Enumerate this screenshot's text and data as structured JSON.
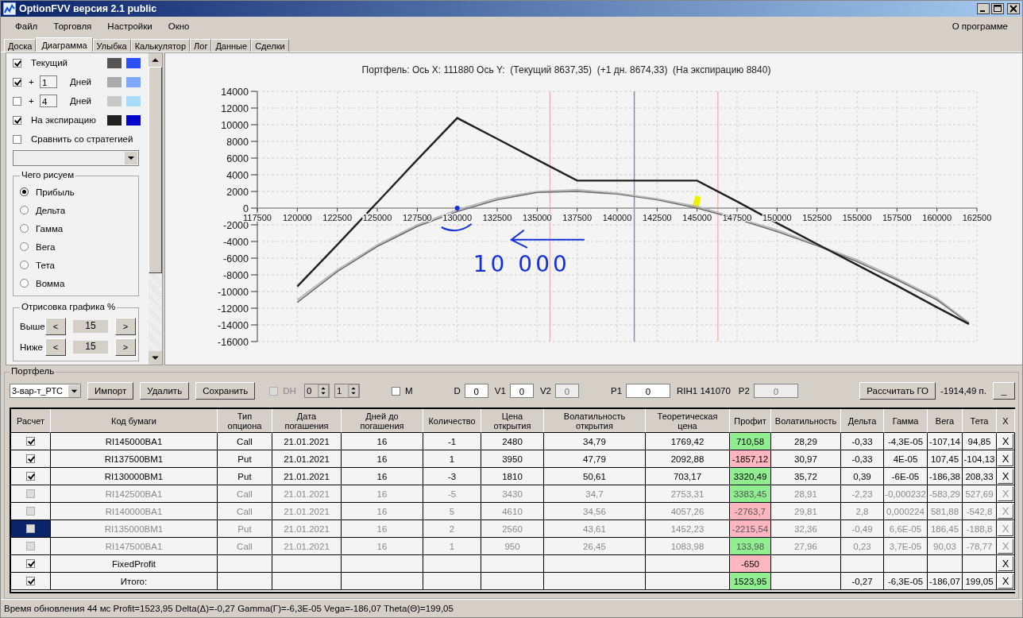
{
  "window": {
    "title": "OptionFVV версия 2.1 public"
  },
  "menu": {
    "items": [
      "Файл",
      "Торговля",
      "Настройки",
      "Окно"
    ],
    "about": "О программе"
  },
  "tabs": [
    {
      "label": "Доска",
      "selected": false
    },
    {
      "label": "Диаграмма",
      "selected": true
    },
    {
      "label": "Улыбка",
      "selected": false
    },
    {
      "label": "Калькулятор",
      "selected": false
    },
    {
      "label": "Лог",
      "selected": false
    },
    {
      "label": "Данные",
      "selected": false
    },
    {
      "label": "Сделки",
      "selected": false
    }
  ],
  "display": {
    "series": [
      {
        "label": "Текущий",
        "checked": true,
        "swatches": [
          {
            "color": "#555555"
          },
          {
            "color": "#2a50ff"
          }
        ]
      },
      {
        "prefix": "+",
        "days": "1",
        "label": "Дней",
        "checked": true,
        "swatches": [
          {
            "color": "#a9a9a9"
          },
          {
            "color": "#7fa8ff"
          }
        ]
      },
      {
        "prefix": "+",
        "days": "4",
        "label": "Дней",
        "checked": false,
        "swatches": [
          {
            "color": "#c8c8c8"
          },
          {
            "color": "#a8dcff"
          }
        ]
      },
      {
        "label": "На экспирацию",
        "checked": true,
        "swatches": [
          {
            "color": "#202020"
          },
          {
            "color": "#0000c8"
          }
        ]
      }
    ],
    "compare": {
      "label": "Сравнить со стратегией",
      "checked": false
    },
    "mode_group": {
      "title": "Чего рисуем",
      "options": [
        {
          "label": "Прибыль",
          "selected": true
        },
        {
          "label": "Дельта",
          "selected": false
        },
        {
          "label": "Гамма",
          "selected": false
        },
        {
          "label": "Вега",
          "selected": false
        },
        {
          "label": "Тета",
          "selected": false
        },
        {
          "label": "Вомма",
          "selected": false
        }
      ]
    },
    "range_group": {
      "title": "Отрисовка графика %",
      "rows": [
        {
          "label": "Выше",
          "value": "15",
          "decrease": "<",
          "increase": ">"
        },
        {
          "label": "Ниже",
          "value": "15",
          "decrease": "<",
          "increase": ">"
        }
      ]
    }
  },
  "chart": {
    "title": "Портфель: Ось X: 111880 Ось Y:  (Текущий 8637,35)  (+1 дн. 8674,33)  (На экспирацию 8840)",
    "note": "10 000",
    "chart_data": {
      "type": "line",
      "grid": true,
      "xlim": [
        117500,
        162500
      ],
      "ylim": [
        -16000,
        14000
      ],
      "xticks": [
        117500,
        120000,
        122500,
        125000,
        127500,
        130000,
        132500,
        135000,
        137500,
        140000,
        142500,
        145000,
        147500,
        150000,
        152500,
        155000,
        157500,
        160000,
        162500
      ],
      "yticks": [
        -16000,
        -14000,
        -12000,
        -10000,
        -8000,
        -6000,
        -4000,
        -2000,
        0,
        2000,
        4000,
        6000,
        8000,
        10000,
        12000,
        14000
      ],
      "x": [
        120000,
        122500,
        125000,
        127500,
        130000,
        132500,
        135000,
        137500,
        140000,
        142500,
        145000,
        147500,
        150000,
        152500,
        155000,
        157500,
        160000,
        162000
      ],
      "series": [
        {
          "color": "#6a6a6a",
          "values": [
            -11300,
            -7600,
            -4600,
            -2200,
            -400,
            1000,
            1900,
            2000,
            1700,
            1000,
            0,
            -1300,
            -2800,
            -4500,
            -6400,
            -8600,
            -11000,
            -13800
          ]
        },
        {
          "color": "#b4b4b4",
          "values": [
            -11000,
            -7400,
            -4400,
            -2000,
            -200,
            1200,
            2000,
            2200,
            1800,
            1100,
            200,
            -1200,
            -2600,
            -4400,
            -6200,
            -8400,
            -10800,
            -13700
          ]
        },
        {
          "color": "#202020",
          "values": [
            -9400,
            -4400,
            700,
            5800,
            10800,
            8300,
            5800,
            3300,
            3300,
            3300,
            3300,
            800,
            -1800,
            -4300,
            -6800,
            -9300,
            -11900,
            -13900
          ]
        }
      ],
      "ref_lines": [
        {
          "axis": "x",
          "value": 135800,
          "color": "#ffb0b0"
        },
        {
          "axis": "x",
          "value": 146300,
          "color": "#ffb0b0"
        },
        {
          "axis": "x",
          "value": 141070,
          "color": "#8090a8"
        }
      ]
    }
  },
  "portfolio": {
    "title": "Портфель",
    "strategy": "3-вар-т_РТС",
    "buttons": [
      "Импорт",
      "Удалить",
      "Сохранить"
    ],
    "dh": {
      "label": "DH",
      "checked": false,
      "disabled": true
    },
    "spinners": [
      "0",
      "1"
    ],
    "m": {
      "label": "M",
      "checked": false
    },
    "fields": [
      {
        "label": "D",
        "value": "0",
        "disabled": false
      },
      {
        "label": "V1",
        "value": "0",
        "disabled": false
      },
      {
        "label": "V2",
        "value": "0",
        "disabled": true
      },
      {
        "label": "P1",
        "value": "0",
        "disabled": false
      }
    ],
    "ticker": "RIH1 141070",
    "p2": {
      "label": "P2",
      "value": "0",
      "disabled": true
    },
    "calc_button": "Рассчитать ГО",
    "margin": "-1914,49 п.",
    "minimize_button": "_"
  },
  "table": {
    "check_column": "Расчет",
    "delete_column": "X",
    "columns": [
      "Код бумаги",
      "Тип опциона",
      "Дата погашения",
      "Дней до погашения",
      "Количество",
      "Цена открытия",
      "Волатильность открытия",
      "Теоретическая цена",
      "Профит",
      "Волатильность",
      "Дельта",
      "Гамма",
      "Вега",
      "Тета"
    ],
    "rows": [
      {
        "checked": true,
        "enabled": true,
        "selected": false,
        "color": "#90ee90",
        "delete": "X",
        "cells": [
          "RI145000BA1",
          "Call",
          "21.01.2021",
          "16",
          "-1",
          "2480",
          "34,79",
          "1769,42",
          "710,58",
          "28,29",
          "-0,33",
          "-4,3E-05",
          "-107,14",
          "94,85"
        ]
      },
      {
        "checked": true,
        "enabled": true,
        "selected": false,
        "color": "#ffb6c1",
        "delete": "X",
        "cells": [
          "RI137500BM1",
          "Put",
          "21.01.2021",
          "16",
          "1",
          "3950",
          "47,79",
          "2092,88",
          "-1857,12",
          "30,97",
          "-0,33",
          "4E-05",
          "107,45",
          "-104,13"
        ]
      },
      {
        "checked": true,
        "enabled": true,
        "selected": false,
        "color": "#90ee90",
        "delete": "X",
        "cells": [
          "RI130000BM1",
          "Put",
          "21.01.2021",
          "16",
          "-3",
          "1810",
          "50,61",
          "703,17",
          "3320,49",
          "35,72",
          "0,39",
          "-6E-05",
          "-186,38",
          "208,33"
        ]
      },
      {
        "checked": false,
        "enabled": false,
        "selected": false,
        "color": "#90ee90",
        "delete": "X",
        "cells": [
          "RI142500BA1",
          "Call",
          "21.01.2021",
          "16",
          "-5",
          "3430",
          "34,7",
          "2753,31",
          "3383,45",
          "28,91",
          "-2,23",
          "-0,000232",
          "-583,29",
          "527,69"
        ]
      },
      {
        "checked": false,
        "enabled": false,
        "selected": false,
        "color": "#ffb6c1",
        "delete": "X",
        "cells": [
          "RI140000BA1",
          "Call",
          "21.01.2021",
          "16",
          "5",
          "4610",
          "34,56",
          "4057,26",
          "-2763,7",
          "29,81",
          "2,8",
          "0,000224",
          "581,88",
          "-542,8"
        ]
      },
      {
        "checked": false,
        "enabled": false,
        "selected": true,
        "color": "#ffb6c1",
        "delete": "X",
        "cells": [
          "RI135000BM1",
          "Put",
          "21.01.2021",
          "16",
          "2",
          "2560",
          "43,61",
          "1452,23",
          "-2215,54",
          "32,36",
          "-0,49",
          "6,6E-05",
          "186,45",
          "-188,8"
        ]
      },
      {
        "checked": false,
        "enabled": false,
        "selected": false,
        "color": "#90ee90",
        "delete": "X",
        "cells": [
          "RI147500BA1",
          "Call",
          "21.01.2021",
          "16",
          "1",
          "950",
          "26,45",
          "1083,98",
          "133,98",
          "27,96",
          "0,23",
          "3,7E-05",
          "90,03",
          "-78,77"
        ]
      },
      {
        "checked": true,
        "enabled": true,
        "selected": false,
        "color": "#ffb6c1",
        "delete": "X",
        "cells": [
          "FixedProfit",
          null,
          null,
          null,
          null,
          null,
          null,
          null,
          "-650",
          null,
          null,
          null,
          null,
          null
        ]
      },
      {
        "checked": true,
        "enabled": true,
        "selected": false,
        "color": "#90ee90",
        "delete": "X",
        "cells": [
          "Итого:",
          null,
          null,
          null,
          null,
          null,
          null,
          null,
          "1523,95",
          null,
          "-0,27",
          "-6,3E-05",
          "-186,07",
          "199,05"
        ]
      }
    ]
  },
  "status_bar": "Время обновления 44 мс  Profit=1523,95 Delta(Δ)=-0,27 Gamma(Γ)=-6,3E-05 Vega=-186,07 Theta(Θ)=199,05"
}
